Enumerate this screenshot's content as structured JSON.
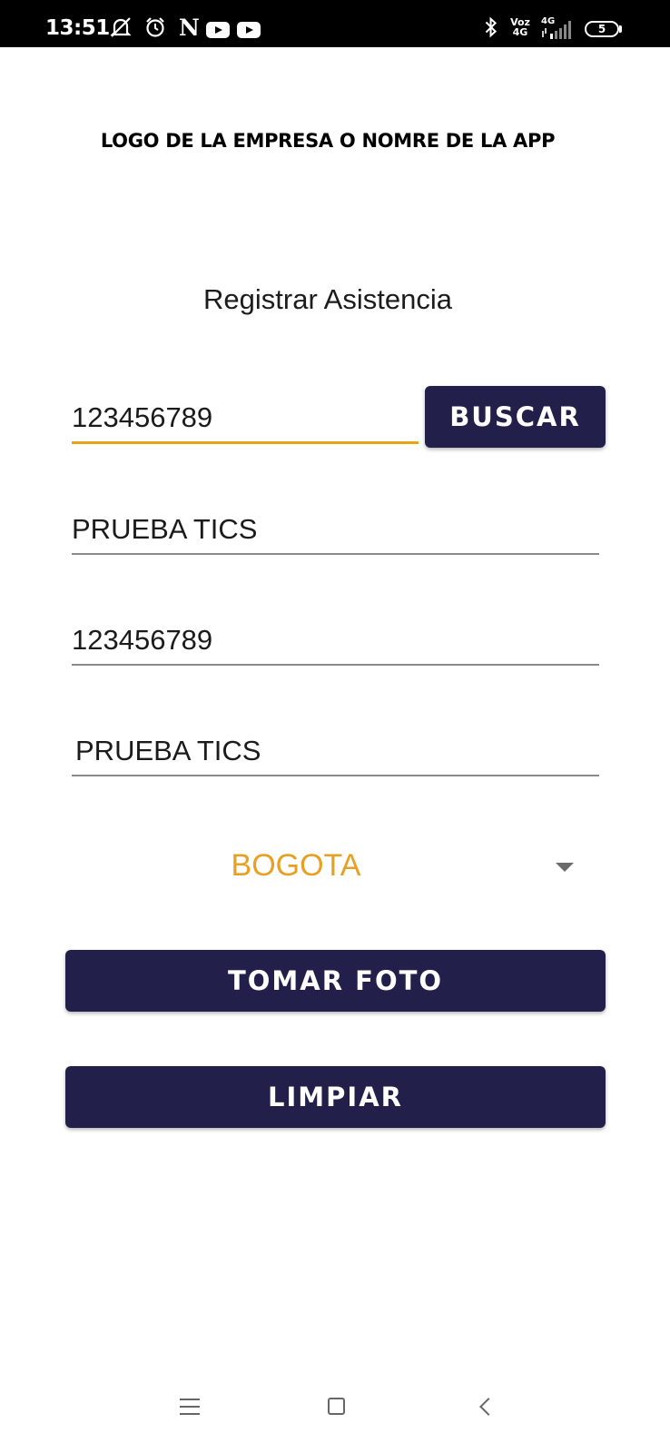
{
  "status_bar": {
    "time": "13:51",
    "icons": [
      "alarm-off-icon",
      "alarm-clock-icon",
      "netflix-icon",
      "youtube-icon",
      "youtube-icon",
      "bluetooth-icon",
      "volte-icon",
      "signal-4g-icon",
      "battery-icon"
    ],
    "netflix_letter": "N",
    "voz_label": "Voz",
    "voz_sub": "4G",
    "network_label": "4G",
    "battery_level": "5"
  },
  "header": {
    "logo_text": "LOGO DE LA EMPRESA O NOMRE DE LA APP"
  },
  "form": {
    "title": "Registrar Asistencia",
    "search_input_value": "123456789",
    "search_button_label": "BUSCAR",
    "name_value": "PRUEBA TICS",
    "document_value": "123456789",
    "company_value": "PRUEBA TICS",
    "city_selected": "BOGOTA",
    "photo_button_label": "TOMAR FOTO",
    "clear_button_label": "LIMPIAR"
  },
  "colors": {
    "primary_button": "#22204a",
    "accent": "#e8a317",
    "status_bar": "#000000"
  },
  "nav_bar": {
    "icons": [
      "menu-icon",
      "home-icon",
      "back-icon"
    ]
  }
}
